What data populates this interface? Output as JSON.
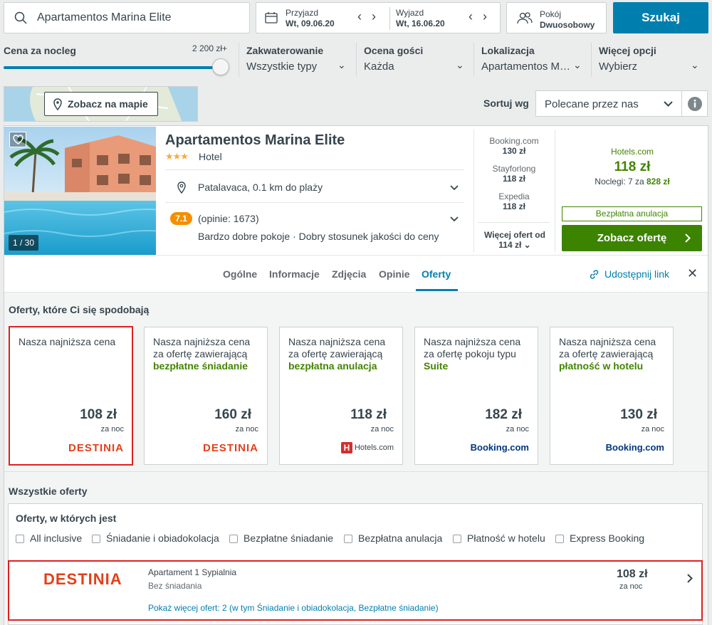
{
  "search": {
    "query": "Apartamentos Marina Elite",
    "checkin_label": "Przyjazd",
    "checkin_value": "Wt, 09.06.20",
    "checkout_label": "Wyjazd",
    "checkout_value": "Wt, 16.06.20",
    "room_label": "Pokój",
    "room_value": "Dwuosobowy",
    "search_button": "Szukaj"
  },
  "filters": {
    "price_label": "Cena za nocleg",
    "price_max": "2 200 zł+",
    "price_slider_fraction": 1.0,
    "accommodation_label": "Zakwaterowanie",
    "accommodation_value": "Wszystkie typy",
    "rating_label": "Ocena gości",
    "rating_value": "Każda",
    "location_label": "Lokalizacja",
    "location_value": "Apartamentos M…",
    "more_label": "Więcej opcji",
    "more_value": "Wybierz"
  },
  "map": {
    "button": "Zobacz na mapie"
  },
  "sort": {
    "label": "Sortuj wg",
    "value": "Polecane przez nas"
  },
  "hotel": {
    "name": "Apartamentos Marina Elite",
    "stars": "★★★",
    "type": "Hotel",
    "image_counter": "1 / 30",
    "location": "Patalavaca, 0.1 km do plaży",
    "rating_score": "7.1",
    "rating_count": "(opinie: 1673)",
    "rating_desc": "Bardzo dobre pokoje · Dobry stosunek jakości do ceny",
    "partners": [
      {
        "name": "Booking.com",
        "price": "130 zł"
      },
      {
        "name": "Stayforlong",
        "price": "118 zł"
      },
      {
        "name": "Expedia",
        "price": "118 zł"
      }
    ],
    "more_offers_label": "Więcej ofert od",
    "more_offers_price": "114 zł",
    "best_site": "Hotels.com",
    "best_price": "118 zł",
    "nights_prefix": "Noclegi: 7 za ",
    "nights_total": "828 zł",
    "free_cancel": "Bezpłatna anulacja",
    "deal_button": "Zobacz ofertę"
  },
  "tabs": [
    "Ogólne",
    "Informacje",
    "Zdjęcia",
    "Opinie",
    "Oferty"
  ],
  "active_tab": "Oferty",
  "share_label": "Udostępnij link",
  "offers_section": {
    "title": "Oferty, które Ci się spodobają",
    "cards": [
      {
        "text": "Nasza najniższa cena",
        "highlight": "",
        "price": "108 zł",
        "per": "za noc",
        "logo": "DESTINIA"
      },
      {
        "text": "Nasza najniższa cena za ofertę zawierającą",
        "highlight": "bezpłatne śniadanie",
        "price": "160 zł",
        "per": "za noc",
        "logo": "DESTINIA"
      },
      {
        "text": "Nasza najniższa cena za ofertę zawierającą",
        "highlight": "bezpłatna anulacja",
        "price": "118 zł",
        "per": "za noc",
        "logo": "Hotels.com"
      },
      {
        "text": "Nasza najniższa cena za ofertę pokoju typu",
        "highlight": "Suite",
        "price": "182 zł",
        "per": "za noc",
        "logo": "Booking.com"
      },
      {
        "text": "Nasza najniższa cena za ofertę zawierającą",
        "highlight": "płatność w hotelu",
        "price": "130 zł",
        "per": "za noc",
        "logo": "Booking.com"
      }
    ]
  },
  "all_offers": {
    "title": "Wszystkie oferty",
    "filter_title": "Oferty, w których jest",
    "checkboxes": [
      "All inclusive",
      "Śniadanie i obiadokolacja",
      "Bezpłatne śniadanie",
      "Bezpłatna anulacja",
      "Płatność w hotelu",
      "Express Booking"
    ],
    "row": {
      "logo": "DESTINIA",
      "room": "Apartament 1 Sypialnia",
      "board": "Bez śniadania",
      "more_link": "Pokaż więcej ofert: 2 (w tym Śniadanie i obiadokolacja, Bezpłatne śniadanie)",
      "price": "108 zł",
      "per": "za noc"
    }
  },
  "colors": {
    "primary": "#007faf",
    "deal_green": "#3c8400",
    "rating_orange": "#f48f00",
    "highlight_red": "#e02020"
  }
}
